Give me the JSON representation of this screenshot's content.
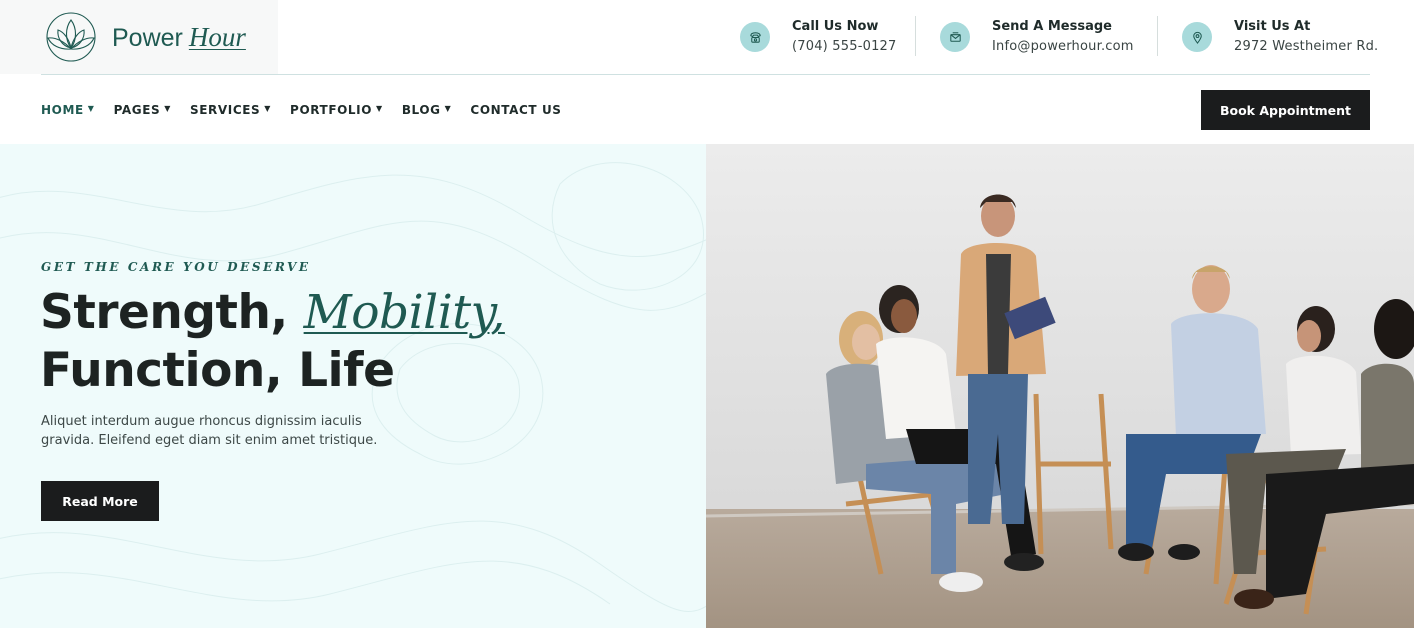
{
  "brand": {
    "name_plain": "Power",
    "name_italic": "Hour",
    "logo_icon": "lotus-icon",
    "accent_color": "#1f5a52",
    "soft_color": "#a8dadb"
  },
  "contacts": [
    {
      "icon": "phone-icon",
      "title": "Call Us Now",
      "value": "(704) 555-0127"
    },
    {
      "icon": "envelope-icon",
      "title": "Send A Message",
      "value": "Info@powerhour.com"
    },
    {
      "icon": "location-pin-icon",
      "title": "Visit Us At",
      "value": "2972 Westheimer Rd."
    }
  ],
  "nav": {
    "items": [
      {
        "label": "HOME",
        "dropdown": true,
        "active": true
      },
      {
        "label": "PAGES",
        "dropdown": true
      },
      {
        "label": "SERVICES",
        "dropdown": true
      },
      {
        "label": "PORTFOLIO",
        "dropdown": true
      },
      {
        "label": "BLOG",
        "dropdown": true
      },
      {
        "label": "CONTACT US",
        "dropdown": false
      }
    ],
    "cta_label": "Book Appointment"
  },
  "hero": {
    "eyebrow": "GET THE CARE YOU DESERVE",
    "headline_part1": "Strength, ",
    "headline_accent": "Mobility,",
    "headline_line2": "Function, Life",
    "description": "Aliquet interdum augue rhoncus dignissim iaculis gravida. Eleifend eget diam sit enim amet tristique.",
    "button_label": "Read More",
    "background_color": "#effbfb"
  }
}
